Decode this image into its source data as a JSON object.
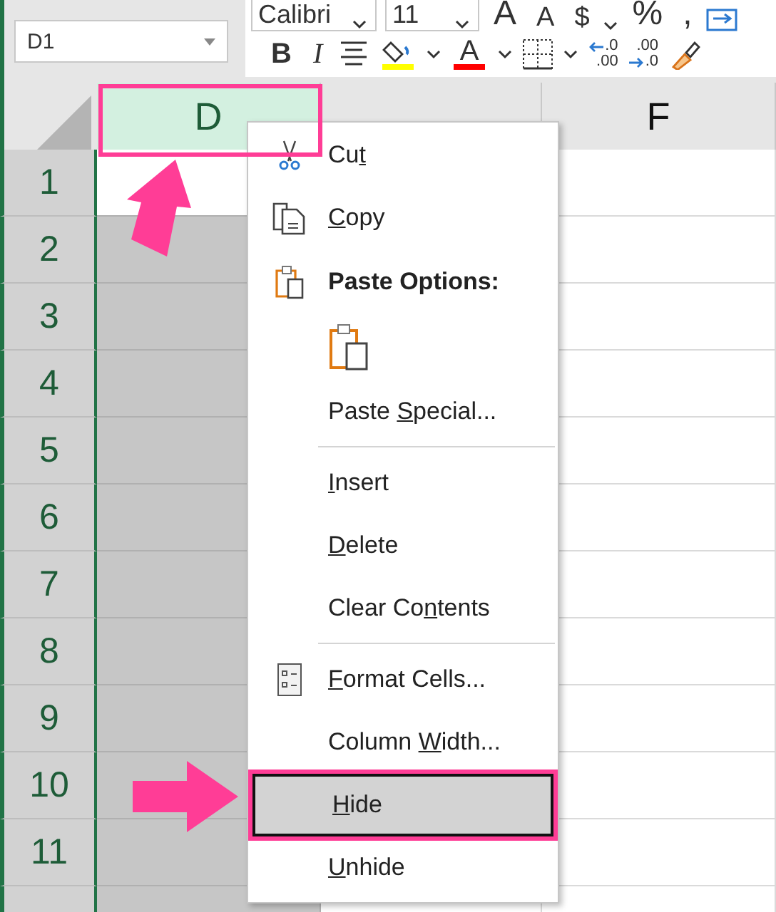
{
  "name_box": {
    "value": "D1"
  },
  "ribbon": {
    "row1": [
      {
        "kind": "combo",
        "text": "Calibri"
      },
      {
        "kind": "combo",
        "text": "11"
      },
      {
        "kind": "bigletter",
        "text": "A"
      },
      {
        "kind": "letter",
        "text": "A"
      },
      {
        "kind": "letter",
        "text": "$"
      },
      {
        "kind": "caret"
      },
      {
        "kind": "bigletter",
        "text": "%"
      },
      {
        "kind": "bigletter",
        "text": ","
      },
      {
        "kind": "wrap"
      }
    ],
    "row2": [
      {
        "kind": "bold",
        "text": "B"
      },
      {
        "kind": "italic",
        "text": "I"
      },
      {
        "kind": "align"
      },
      {
        "kind": "fill-color",
        "color": "#ffff00"
      },
      {
        "kind": "caret"
      },
      {
        "kind": "font-color",
        "text": "A",
        "color": "#ff0000"
      },
      {
        "kind": "caret"
      },
      {
        "kind": "borders"
      },
      {
        "kind": "caret"
      },
      {
        "kind": "increase",
        "top": ".0",
        "bottom": ".00"
      },
      {
        "kind": "decrease",
        "top": ".00",
        "bottom": ".0"
      },
      {
        "kind": "painter"
      }
    ]
  },
  "columns": [
    {
      "label": "D",
      "selected": true
    },
    {
      "selected": false
    },
    {
      "label": "F",
      "selected": false
    }
  ],
  "rows": [
    "1",
    "2",
    "3",
    "4",
    "5",
    "6",
    "7",
    "8",
    "9",
    "10",
    "11"
  ],
  "context_menu": [
    {
      "kind": "cut",
      "parts": [
        {
          "text": "Cu",
          "underlined": false
        },
        {
          "text": "t",
          "underlined": true
        }
      ],
      "selected": false
    },
    {
      "kind": "copy",
      "parts": [
        {
          "text": "C",
          "underlined": true
        },
        {
          "text": "opy",
          "underlined": false
        }
      ],
      "selected": false
    },
    {
      "kind": "header",
      "label": "Paste Options:"
    },
    {
      "kind": "paste-option"
    },
    {
      "kind": "item",
      "parts": [
        {
          "text": "Paste ",
          "underlined": false
        },
        {
          "text": "S",
          "underlined": true
        },
        {
          "text": "pecial...",
          "underlined": false
        }
      ],
      "selected": false
    },
    {
      "kind": "separator"
    },
    {
      "kind": "item",
      "parts": [
        {
          "text": "I",
          "underlined": true
        },
        {
          "text": "nsert",
          "underlined": false
        }
      ],
      "selected": false
    },
    {
      "kind": "item",
      "parts": [
        {
          "text": "D",
          "underlined": true
        },
        {
          "text": "elete",
          "underlined": false
        }
      ],
      "selected": false
    },
    {
      "kind": "item",
      "parts": [
        {
          "text": "Clear Co",
          "underlined": false
        },
        {
          "text": "n",
          "underlined": true
        },
        {
          "text": "tents",
          "underlined": false
        }
      ],
      "selected": false
    },
    {
      "kind": "separator"
    },
    {
      "kind": "format",
      "parts": [
        {
          "text": "F",
          "underlined": true
        },
        {
          "text": "ormat Cells...",
          "underlined": false
        }
      ],
      "selected": false
    },
    {
      "kind": "item",
      "parts": [
        {
          "text": "Column ",
          "underlined": false
        },
        {
          "text": "W",
          "underlined": true
        },
        {
          "text": "idth...",
          "underlined": false
        }
      ],
      "selected": false
    },
    {
      "kind": "item",
      "parts": [
        {
          "text": "H",
          "underlined": true
        },
        {
          "text": "ide",
          "underlined": false
        }
      ],
      "selected": true
    },
    {
      "kind": "item",
      "parts": [
        {
          "text": "U",
          "underlined": true
        },
        {
          "text": "nhide",
          "underlined": false
        }
      ],
      "selected": false
    }
  ]
}
